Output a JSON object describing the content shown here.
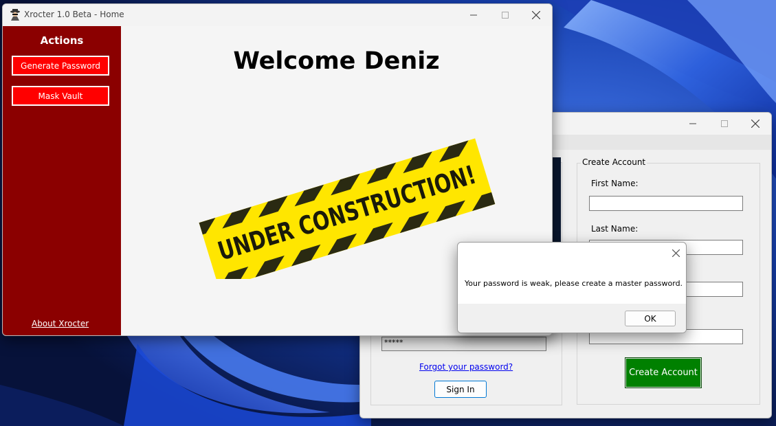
{
  "home_window": {
    "title": "Xrocter 1.0 Beta - Home",
    "sidebar": {
      "heading": "Actions",
      "buttons": [
        {
          "label": "Generate Password"
        },
        {
          "label": "Mask Vault"
        }
      ],
      "about_link": "About Xrocter"
    },
    "welcome": "Welcome Deniz",
    "banner_text": "UNDER CONSTRUCTION!",
    "colors": {
      "sidebar": "#8b0000",
      "button": "#ff0000"
    }
  },
  "account_window": {
    "password_value": "*****",
    "forgot_link": "Forgot your password?",
    "sign_in_label": "Sign In",
    "create_group": {
      "legend": "Create Account",
      "fields": [
        {
          "label": "First Name:"
        },
        {
          "label": "Last Name:"
        }
      ],
      "button_label": "Create Account"
    },
    "colors": {
      "create_button": "#008000"
    }
  },
  "dialog": {
    "message": "Your password is weak, please create a master password.",
    "ok_label": "OK"
  }
}
